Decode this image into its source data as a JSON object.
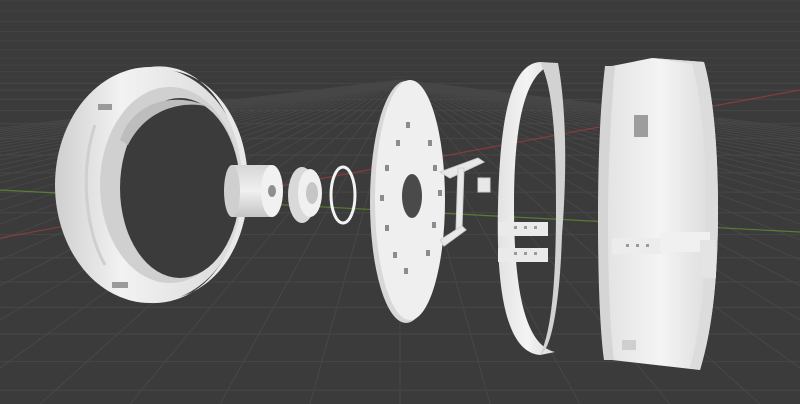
{
  "viewport": {
    "background": "#3b3b3b",
    "grid_color": "#474747",
    "x_axis_color": "#a33a3a",
    "y_axis_color": "#5e8f2f",
    "part_color": "#e6e6e6",
    "part_shadow": "#c9c9c9"
  },
  "parts": [
    {
      "name": "outer-ring-housing"
    },
    {
      "name": "hub-cylinder"
    },
    {
      "name": "bearing-cap"
    },
    {
      "name": "o-ring"
    },
    {
      "name": "slotted-disc"
    },
    {
      "name": "bracket-arm"
    },
    {
      "name": "thin-ring-segment"
    },
    {
      "name": "outer-shell-ring"
    }
  ]
}
